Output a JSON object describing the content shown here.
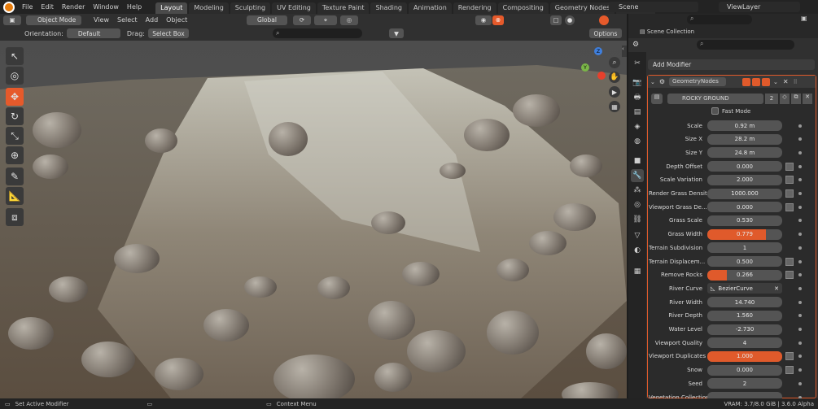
{
  "menu": [
    "File",
    "Edit",
    "Render",
    "Window",
    "Help"
  ],
  "workspaces": [
    "Layout",
    "Modeling",
    "Sculpting",
    "UV Editing",
    "Texture Paint",
    "Shading",
    "Animation",
    "Rendering",
    "Compositing",
    "Geometry Nodes",
    "Scripting"
  ],
  "scene": "Scene",
  "view_layer": "ViewLayer",
  "viewport_header": {
    "mode": "Object Mode",
    "menus": [
      "View",
      "Select",
      "Add",
      "Object"
    ],
    "transform": "Global",
    "orientation_label": "Orientation:",
    "orientation_value": "Default",
    "drag_label": "Drag:",
    "drag_value": "Select Box",
    "options": "Options"
  },
  "gizmo": {
    "y": "Y",
    "z": "Z"
  },
  "outliner": {
    "scene_collection": "Scene Collection"
  },
  "properties": {
    "add_modifier": "Add Modifier",
    "modifier_name": "GeometryNodes",
    "node_group": "ROCKY GROUND",
    "node_group_users": "2",
    "fast_mode": "Fast Mode",
    "inputs": [
      {
        "label": "Scale",
        "value": "0.92 m"
      },
      {
        "label": "Size X",
        "value": "28.2 m"
      },
      {
        "label": "Size Y",
        "value": "24.8 m"
      },
      {
        "label": "Depth Offset",
        "value": "0.000",
        "node": true
      },
      {
        "label": "Scale Variation",
        "value": "2.000",
        "node": true
      },
      {
        "label": "Render Grass Density",
        "value": "1000.000",
        "node": true
      },
      {
        "label": "Viewport Grass De...",
        "value": "0.000",
        "node": true
      },
      {
        "label": "Grass Scale",
        "value": "0.530"
      },
      {
        "label": "Grass Width",
        "value": "0.779",
        "fill": 0.779
      },
      {
        "label": "Terrain Subdivision",
        "value": "1"
      },
      {
        "label": "Terrain Displacem...",
        "value": "0.500",
        "node": true
      },
      {
        "label": "Remove Rocks",
        "value": "0.266",
        "fill": 0.266,
        "node": true
      },
      {
        "label": "River Curve",
        "value": "BezierCurve",
        "object": true
      },
      {
        "label": "River Width",
        "value": "14.740"
      },
      {
        "label": "River Depth",
        "value": "1.560"
      },
      {
        "label": "Water Level",
        "value": "-2.730"
      },
      {
        "label": "Viewport Quality",
        "value": "4"
      },
      {
        "label": "Viewport Duplicates",
        "value": "1.000",
        "fill": 1.0,
        "node": true
      },
      {
        "label": "Snow",
        "value": "0.000",
        "node": true
      },
      {
        "label": "Seed",
        "value": "2"
      },
      {
        "label": "Vegetation Collection",
        "value": ""
      }
    ]
  },
  "status": {
    "left": "Set Active Modifier",
    "middle": "Context Menu",
    "right": "VRAM: 3.7/8.0 GiB | 3.6.0 Alpha"
  },
  "colors": {
    "accent": "#e65a2b",
    "field": "#545454",
    "panel": "#303030"
  }
}
